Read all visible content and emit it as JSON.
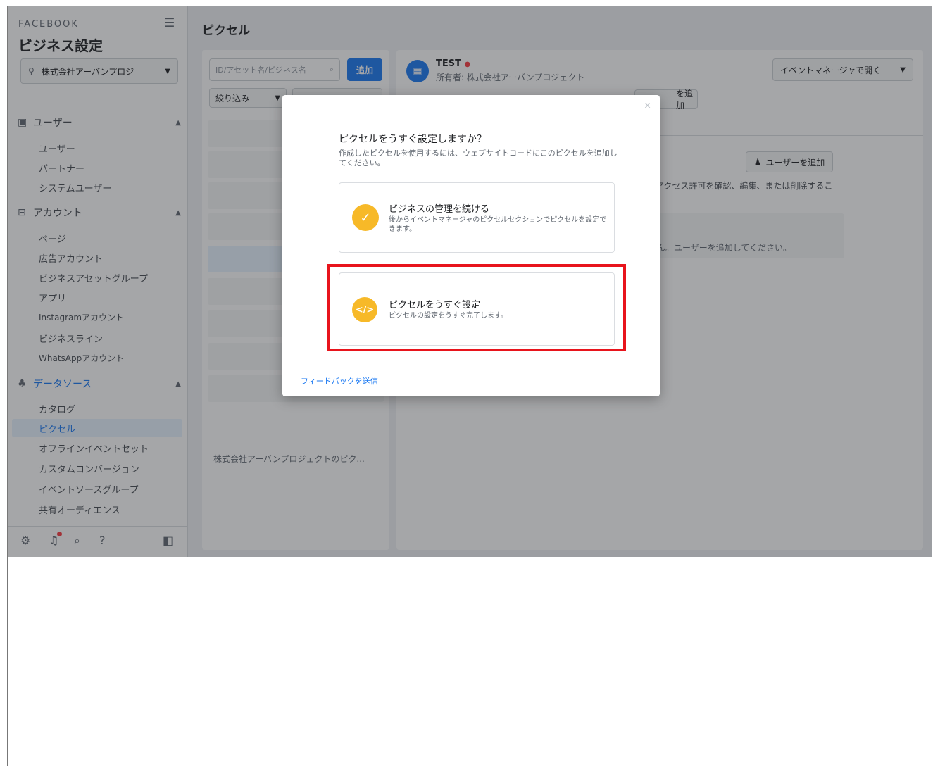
{
  "sidebar": {
    "brand": "FACEBOOK",
    "title": "ビジネス設定",
    "business_name": "株式会社アーバンプロジ",
    "sections": [
      {
        "label": "ユーザー",
        "items": [
          "ユーザー",
          "パートナー",
          "システムユーザー"
        ]
      },
      {
        "label": "アカウント",
        "items": [
          "ページ",
          "広告アカウント",
          "ビジネスアセットグループ",
          "アプリ",
          "Instagramアカウント",
          "ビジネスライン",
          "WhatsAppアカウント"
        ]
      },
      {
        "label": "データソース",
        "items": [
          "カタログ",
          "ピクセル",
          "オフラインイベントセット",
          "カスタムコンバージョン",
          "イベントソースグループ",
          "共有オーディエンス"
        ]
      }
    ]
  },
  "main": {
    "page_title": "ピクセル",
    "search_placeholder": "ID/アセット名/ビジネス名",
    "add_button": "追加",
    "filter_label": "絞り込み",
    "list_footer": "株式会社アーバンプロジェクトのピク..."
  },
  "detail": {
    "pixel_name": "TEST",
    "owner": "所有者: 株式会社アーバンプロジェクト",
    "open_event_manager": "イベントマネージャで開く",
    "add_asset": "を追加",
    "add_user_button": "ユーザーを追加",
    "access_desc": "アクセス許可を確認、編集、または削除するこ",
    "info_text": "ん。ユーザーを追加してください。"
  },
  "modal": {
    "question": "ピクセルをうすぐ設定しますか？",
    "subtitle": "作成したピクセルを使用するには、ウェブサイトコードにこのピクセルを追加してください。",
    "options": [
      {
        "title": "ビジネスの管理を続ける",
        "desc": "後からイベントマネージャのピクセルセクションでピクセルを設定できます。",
        "icon": "check-icon"
      },
      {
        "title": "ピクセルをうすぐ設定",
        "desc": "ピクセルの設定をうすぐ完了します。",
        "icon": "code-icon"
      }
    ],
    "feedback": "フィードバックを送信",
    "highlight_color": "#e8141c",
    "accent_color": "#f7b928"
  }
}
